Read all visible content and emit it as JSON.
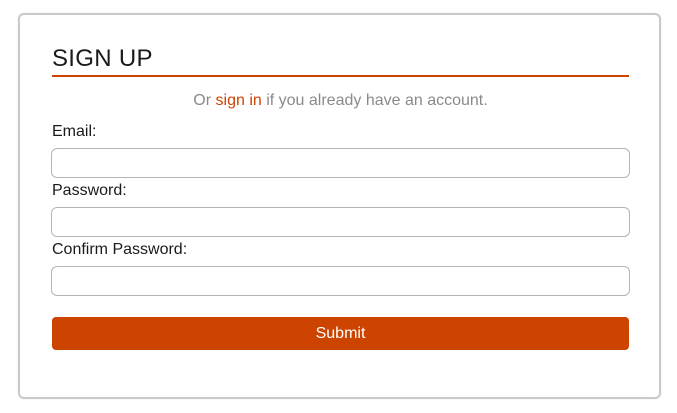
{
  "form": {
    "title": "SIGN UP",
    "subtext_prefix": "Or ",
    "signin_link": "sign in",
    "subtext_suffix": " if you already have an account.",
    "email_label": "Email:",
    "email_value": "",
    "password_label": "Password:",
    "password_value": "",
    "confirm_label": "Confirm Password:",
    "confirm_value": "",
    "submit_label": "Submit"
  },
  "colors": {
    "accent": "#cc4400",
    "border": "#c9c9c9",
    "muted_text": "#8a8a8a"
  }
}
